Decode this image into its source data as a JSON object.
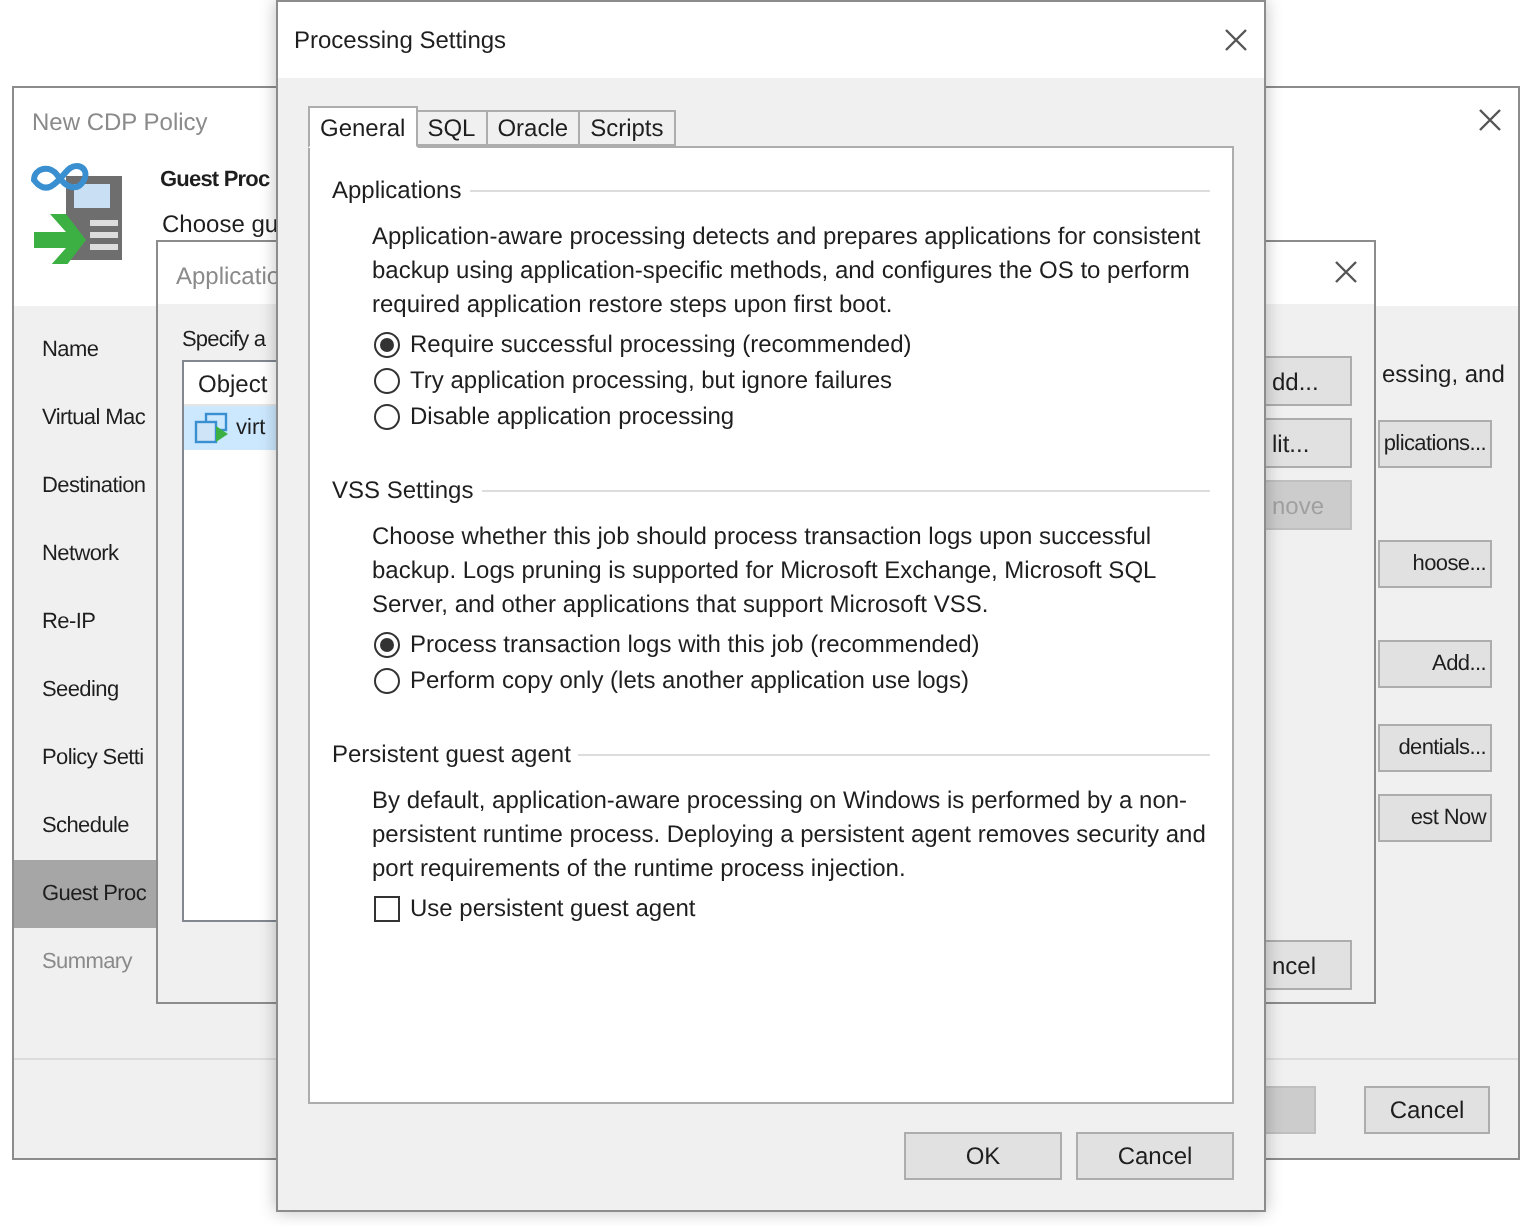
{
  "back_window": {
    "title": "New CDP Policy",
    "heading": "Guest Proc",
    "subheading": "Choose gu",
    "steps": [
      {
        "label": "Name",
        "selected": false,
        "disabled": false
      },
      {
        "label": "Virtual Mac",
        "selected": false,
        "disabled": false
      },
      {
        "label": "Destination",
        "selected": false,
        "disabled": false
      },
      {
        "label": "Network",
        "selected": false,
        "disabled": false
      },
      {
        "label": "Re-IP",
        "selected": false,
        "disabled": false
      },
      {
        "label": "Seeding",
        "selected": false,
        "disabled": false
      },
      {
        "label": "Policy Setti",
        "selected": false,
        "disabled": false
      },
      {
        "label": "Schedule",
        "selected": false,
        "disabled": false
      },
      {
        "label": "Guest Proc",
        "selected": true,
        "disabled": false
      },
      {
        "label": "Summary",
        "selected": false,
        "disabled": true
      }
    ],
    "description": "essing, and",
    "side_buttons": [
      "plications...",
      "hoose...",
      "Add...",
      "dentials...",
      "est Now"
    ],
    "footer_buttons": [
      {
        "disabled": true
      },
      {
        "label": "Cancel",
        "disabled": false
      }
    ]
  },
  "middle_window": {
    "title": "Applicatio",
    "prompt": "Specify a",
    "column": "Object",
    "rows": [
      {
        "label": "virt",
        "selected": true
      }
    ],
    "list_buttons": [
      {
        "label": "dd...",
        "disabled": false
      },
      {
        "label": "lit...",
        "disabled": false
      },
      {
        "label": "nove",
        "disabled": true
      }
    ],
    "cancel_button": "ncel"
  },
  "front_window": {
    "title": "Processing Settings",
    "tabs": [
      {
        "label": "General",
        "selected": true
      },
      {
        "label": "SQL",
        "selected": false
      },
      {
        "label": "Oracle",
        "selected": false
      },
      {
        "label": "Scripts",
        "selected": false
      }
    ],
    "sections": [
      {
        "title": "Applications",
        "items": [
          {
            "kind": "text",
            "text": "Application-aware processing detects and prepares applications for consistent backup using application-specific methods, and configures the OS to perform required application restore steps upon first boot."
          },
          {
            "kind": "radio",
            "label": "Require successful processing (recommended)",
            "selected": true
          },
          {
            "kind": "radio",
            "label": "Try application processing, but ignore failures",
            "selected": false
          },
          {
            "kind": "radio",
            "label": "Disable application processing",
            "selected": false
          }
        ]
      },
      {
        "title": "VSS Settings",
        "items": [
          {
            "kind": "text",
            "text": "Choose whether this job should process transaction logs upon successful backup. Logs pruning is supported for Microsoft Exchange, Microsoft SQL Server, and other applications that support Microsoft VSS."
          },
          {
            "kind": "radio",
            "label": "Process transaction logs with this job (recommended)",
            "selected": true
          },
          {
            "kind": "radio",
            "label": "Perform copy only (lets another application use logs)",
            "selected": false
          }
        ]
      },
      {
        "title": "Persistent guest agent",
        "items": [
          {
            "kind": "text",
            "text": "By default, application-aware processing on Windows is performed by a non-persistent runtime process. Deploying a persistent agent removes security and port requirements of the runtime process injection."
          },
          {
            "kind": "checkbox",
            "label": "Use persistent guest agent",
            "checked": false
          }
        ]
      }
    ],
    "buttons": [
      "OK",
      "Cancel"
    ]
  }
}
